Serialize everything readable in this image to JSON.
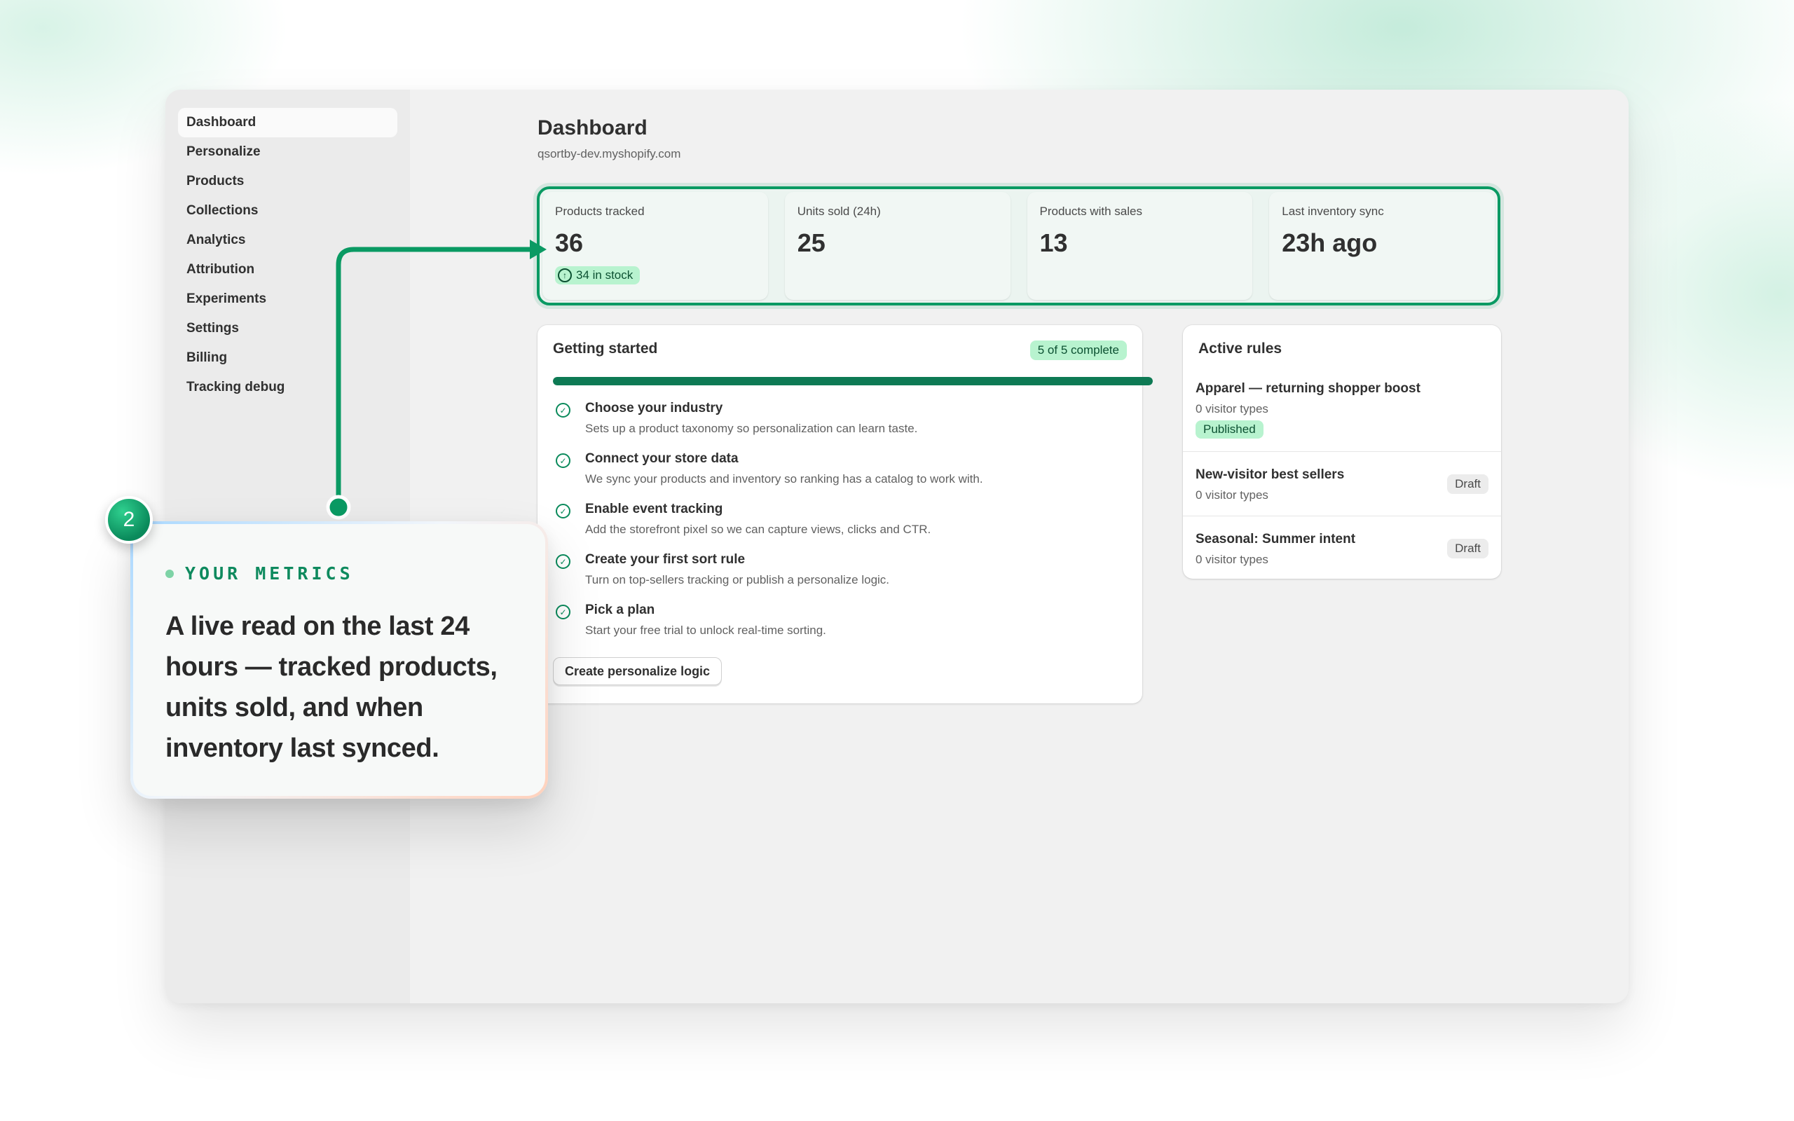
{
  "sidebar": {
    "items": [
      {
        "label": "Dashboard",
        "active": true
      },
      {
        "label": "Personalize"
      },
      {
        "label": "Products"
      },
      {
        "label": "Collections"
      },
      {
        "label": "Analytics"
      },
      {
        "label": "Attribution"
      },
      {
        "label": "Experiments"
      },
      {
        "label": "Settings"
      },
      {
        "label": "Billing"
      },
      {
        "label": "Tracking debug"
      }
    ]
  },
  "header": {
    "title": "Dashboard",
    "store_domain": "qsortby-dev.myshopify.com"
  },
  "metrics": [
    {
      "label": "Products tracked",
      "value": "36",
      "badge": "34 in stock"
    },
    {
      "label": "Units sold (24h)",
      "value": "25"
    },
    {
      "label": "Products with sales",
      "value": "13"
    },
    {
      "label": "Last inventory sync",
      "value": "23h ago"
    }
  ],
  "getting_started": {
    "title": "Getting started",
    "badge": "5 of 5 complete",
    "progress_fraction": 1.0,
    "steps": [
      {
        "title": "Choose your industry",
        "description": "Sets up a product taxonomy so personalization can learn taste."
      },
      {
        "title": "Connect your store data",
        "description": "We sync your products and inventory so ranking has a catalog to work with."
      },
      {
        "title": "Enable event tracking",
        "description": "Add the storefront pixel so we can capture views, clicks and CTR."
      },
      {
        "title": "Create your first sort rule",
        "description": "Turn on top-sellers tracking or publish a personalize logic."
      },
      {
        "title": "Pick a plan",
        "description": "Start your free trial to unlock real-time sorting."
      }
    ],
    "cta_label": "Create personalize logic"
  },
  "active_rules": {
    "title": "Active rules",
    "rules": [
      {
        "name": "Apparel — returning shopper boost",
        "meta": "0 visitor types",
        "status": "Published"
      },
      {
        "name": "New-visitor best sellers",
        "meta": "0 visitor types",
        "status": "Draft"
      },
      {
        "name": "Seasonal: Summer intent",
        "meta": "0 visitor types",
        "status": "Draft"
      }
    ]
  },
  "callout": {
    "step_number": "2",
    "eyebrow": "YOUR METRICS",
    "body": "A live read on the last 24 hours — tracked products, units sold, and when inventory last synced."
  },
  "colors": {
    "accent": "#0a9a63",
    "progress": "#0e7a54",
    "success_badge_bg": "#b8f3cf",
    "success_badge_text": "#0c5132"
  }
}
